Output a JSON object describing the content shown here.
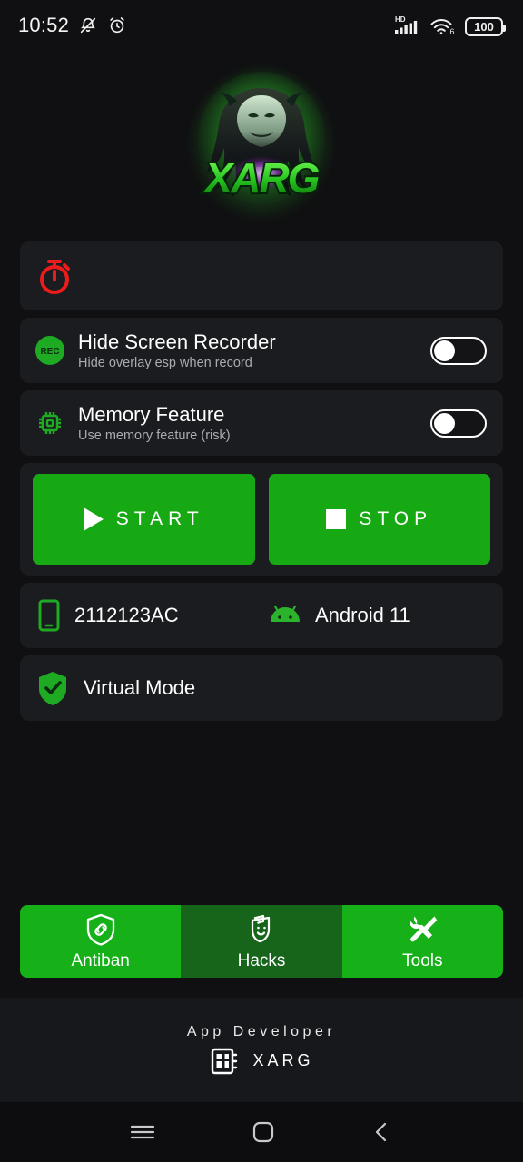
{
  "status_bar": {
    "time": "10:52",
    "icons_left": [
      "mute-bell-icon",
      "alarm-clock-icon"
    ],
    "network_label": "HD",
    "wifi_label": "6",
    "battery_level": "100"
  },
  "logo": {
    "name": "xarg-logo",
    "wordmark": "XARG",
    "glow_color": "#3ce63c"
  },
  "timer_card": {
    "icon": "stopwatch-icon",
    "icon_color": "#ec1c1c"
  },
  "toggles": [
    {
      "icon": "rec-icon",
      "icon_text": "REC",
      "title": "Hide Screen Recorder",
      "subtitle": "Hide overlay esp when record",
      "state": "off"
    },
    {
      "icon": "cpu-chip-icon",
      "title": "Memory Feature",
      "subtitle": "Use memory feature (risk)",
      "state": "off"
    }
  ],
  "actions": {
    "start_label": "START",
    "stop_label": "STOP",
    "button_color": "#16a914"
  },
  "device": {
    "phone_icon": "smartphone-icon",
    "model": "2112123AC",
    "os_icon": "android-icon",
    "os_version": "Android 11"
  },
  "virtual_mode": {
    "icon": "shield-check-icon",
    "label": "Virtual Mode"
  },
  "tabs": [
    {
      "label": "Antiban",
      "icon": "shield-link-icon",
      "active": true
    },
    {
      "label": "Hacks",
      "icon": "theater-masks-icon",
      "active": false
    },
    {
      "label": "Tools",
      "icon": "tools-icon",
      "active": true
    }
  ],
  "footer": {
    "title": "App Developer",
    "icon": "chip-grid-icon",
    "developer": "XARG"
  },
  "nav_bar": {
    "recents": "menu-icon",
    "home": "home-square-icon",
    "back": "back-chevron-icon"
  },
  "colors": {
    "background": "#101012",
    "card": "#1b1c1f",
    "accent_green": "#16b019",
    "accent_green_dark": "#17651a",
    "danger_red": "#ec1c1c"
  }
}
